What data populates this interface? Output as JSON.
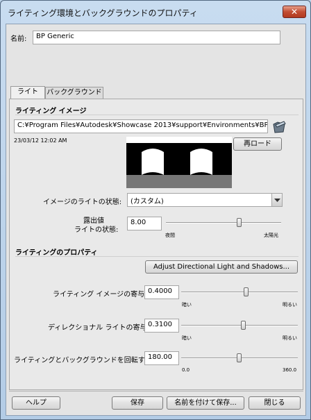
{
  "window": {
    "title": "ライティング環境とバックグラウンドのプロパティ",
    "close_label": "✕"
  },
  "name_field": {
    "label": "名前:",
    "value": "BP Generic"
  },
  "tabs": [
    {
      "label": "ライト"
    },
    {
      "label": "バックグラウンド"
    }
  ],
  "lighting_image": {
    "title": "ライティング イメージ",
    "path": "C:¥Program Files¥Autodesk¥Showcase 2013¥support¥Environments¥BP Generic",
    "timestamp": "23/03/12 12:02 AM",
    "reload_label": "再ロード",
    "state_label": "イメージのライトの状態:",
    "state_value": "(カスタム)",
    "exposure_label_1": "露出値",
    "exposure_label_2": "ライトの状態:",
    "exposure_value": "8.00",
    "exposure_min_label": "夜間",
    "exposure_max_label": "太陽光",
    "exposure_level": 0.64
  },
  "lighting_properties": {
    "title": "ライティングのプロパティ",
    "adjust_button": "Adjust Directional Light and Shadows...",
    "image_contrib": {
      "label": "ライティング イメージの寄与:",
      "value": "0.4000",
      "min": "暗い",
      "max": "明るい",
      "level": 0.55
    },
    "directional_contrib": {
      "label": "ディレクショナル ライトの寄与:",
      "value": "0.3100",
      "min": "暗い",
      "max": "明るい",
      "level": 0.52
    },
    "rotate": {
      "label": "ライティングとバックグラウンドを回転する:",
      "value": "180.00",
      "min": "0.0",
      "max": "360.0",
      "level": 0.5
    }
  },
  "footer": {
    "help_label": "ヘルプ",
    "save_label": "保存",
    "save_as_label": "名前を付けて保存...",
    "close_label": "閉じる"
  },
  "colors": {
    "title_bar": "#bcd3ea",
    "close_button": "#c24d33",
    "panel_bg": "#e4e4e4"
  }
}
